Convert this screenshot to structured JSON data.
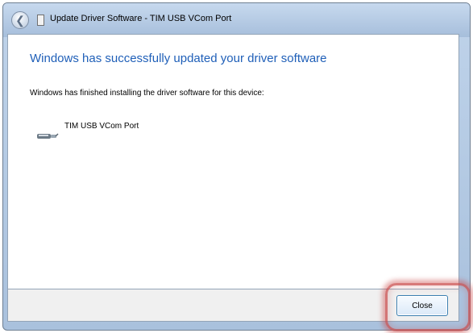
{
  "window": {
    "title": "Update Driver Software - TIM USB VCom Port"
  },
  "content": {
    "heading": "Windows has successfully updated your driver software",
    "message": "Windows has finished installing the driver software for this device:",
    "device": {
      "name": "TIM USB VCom Port",
      "icon": "usb-cable-icon"
    }
  },
  "footer": {
    "close_label": "Close"
  },
  "colors": {
    "heading": "#1f5fb8",
    "highlight": "#c94c4c",
    "button_border": "#3c7fb1"
  }
}
